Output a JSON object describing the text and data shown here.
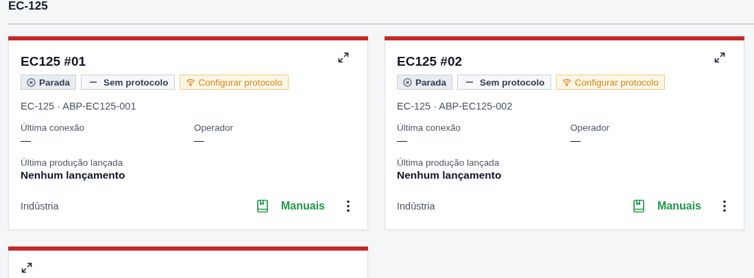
{
  "section": {
    "title": "EC-125"
  },
  "cards": [
    {
      "title": "EC125 #01",
      "color": "#c62828",
      "badges": [
        {
          "kind": "status",
          "label": "Parada"
        },
        {
          "kind": "protocol",
          "label": "Sem protocolo"
        },
        {
          "kind": "configure",
          "label": "Configurar protocolo"
        }
      ],
      "subtitle": "EC-125 · ABP-EC125-001",
      "fields": [
        {
          "label": "Última conexão",
          "value": "—"
        },
        {
          "label": "Operador",
          "value": "—"
        }
      ],
      "production": {
        "label": "Última produção lançada",
        "value": "Nenhum lançamento"
      },
      "footer": {
        "segment": "Indústria",
        "manuals": "Manuais"
      }
    },
    {
      "title": "EC125 #02",
      "color": "#c62828",
      "badges": [
        {
          "kind": "status",
          "label": "Parada"
        },
        {
          "kind": "protocol",
          "label": "Sem protocolo"
        },
        {
          "kind": "configure",
          "label": "Configurar protocolo"
        }
      ],
      "subtitle": "EC-125 · ABP-EC125-002",
      "fields": [
        {
          "label": "Última conexão",
          "value": "—"
        },
        {
          "label": "Operador",
          "value": "—"
        }
      ],
      "production": {
        "label": "Última produção lançada",
        "value": "Nenhum lançamento"
      },
      "footer": {
        "segment": "Indústria",
        "manuals": "Manuais"
      }
    },
    {
      "color": "#c62828"
    }
  ]
}
